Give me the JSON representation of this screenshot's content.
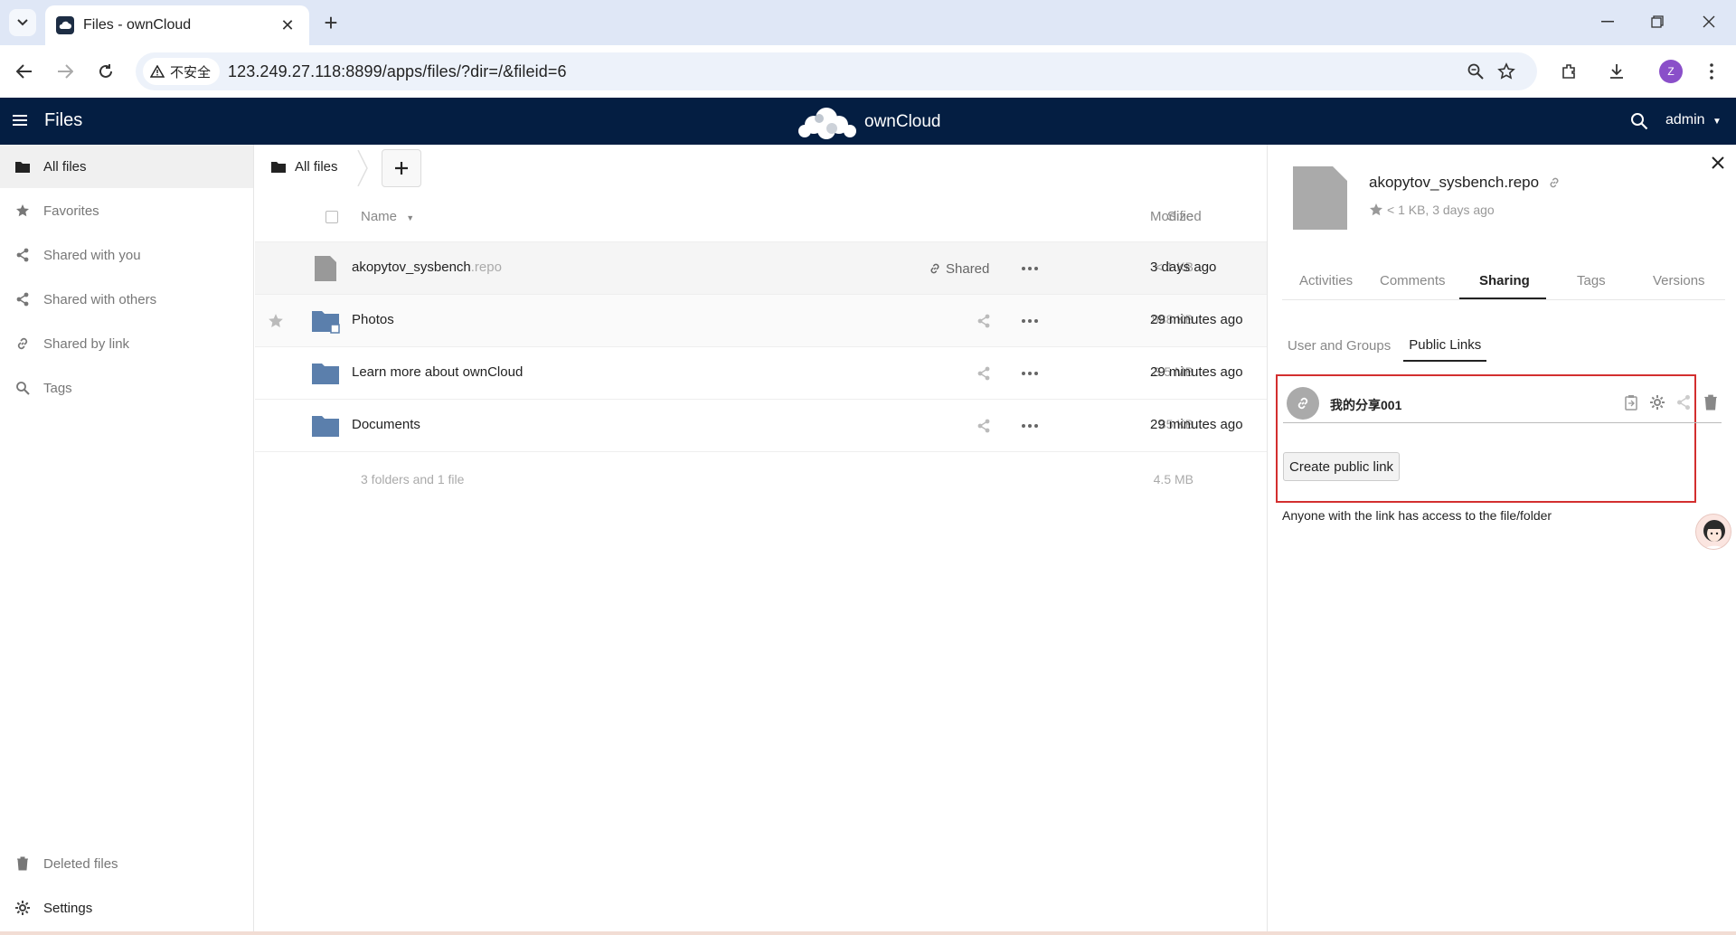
{
  "browser": {
    "tab_title": "Files - ownCloud",
    "security_label": "不安全",
    "url": "123.249.27.118:8899/apps/files/?dir=/&fileid=6",
    "profile_initial": "Z"
  },
  "header": {
    "app_title": "Files",
    "brand": "ownCloud",
    "user": "admin"
  },
  "sidebar": {
    "items": [
      {
        "label": "All files",
        "icon": "folder-icon",
        "active": true
      },
      {
        "label": "Favorites",
        "icon": "star-icon"
      },
      {
        "label": "Shared with you",
        "icon": "share-icon"
      },
      {
        "label": "Shared with others",
        "icon": "share-icon"
      },
      {
        "label": "Shared by link",
        "icon": "link-icon"
      },
      {
        "label": "Tags",
        "icon": "search-icon"
      }
    ],
    "bottom": [
      {
        "label": "Deleted files",
        "icon": "trash-icon"
      },
      {
        "label": "Settings",
        "icon": "gear-icon"
      }
    ]
  },
  "files": {
    "breadcrumb": "All files",
    "columns": {
      "name": "Name",
      "size": "Size",
      "modified": "Modified"
    },
    "rows": [
      {
        "name": "akopytov_sysbench",
        "ext": ".repo",
        "share_label": "Shared",
        "size": "< 1 KB",
        "modified": "3 days ago",
        "type": "file"
      },
      {
        "name": "Photos",
        "ext": "",
        "share_label": "",
        "size": "988 KB",
        "modified": "29 minutes ago",
        "type": "folder"
      },
      {
        "name": "Learn more about ownCloud",
        "ext": "",
        "share_label": "",
        "size": "3.5 MB",
        "modified": "29 minutes ago",
        "type": "folder"
      },
      {
        "name": "Documents",
        "ext": "",
        "share_label": "",
        "size": "35 KB",
        "modified": "29 minutes ago",
        "type": "folder"
      }
    ],
    "summary": {
      "text": "3 folders and 1 file",
      "size": "4.5 MB"
    }
  },
  "details": {
    "file_name": "akopytov_sysbench.repo",
    "meta": "< 1 KB, 3 days ago",
    "tabs": [
      "Activities",
      "Comments",
      "Sharing",
      "Tags",
      "Versions"
    ],
    "active_tab": "Sharing",
    "share_subtabs": [
      "User and Groups",
      "Public Links"
    ],
    "active_subtab": "Public Links",
    "public_link_name": "我的分享001",
    "create_button": "Create public link",
    "info": "Anyone with the link has access to the file/folder"
  },
  "colors": {
    "header_bg": "#041e42",
    "folder": "#5b7fac",
    "highlight_border": "#d32f2f"
  }
}
